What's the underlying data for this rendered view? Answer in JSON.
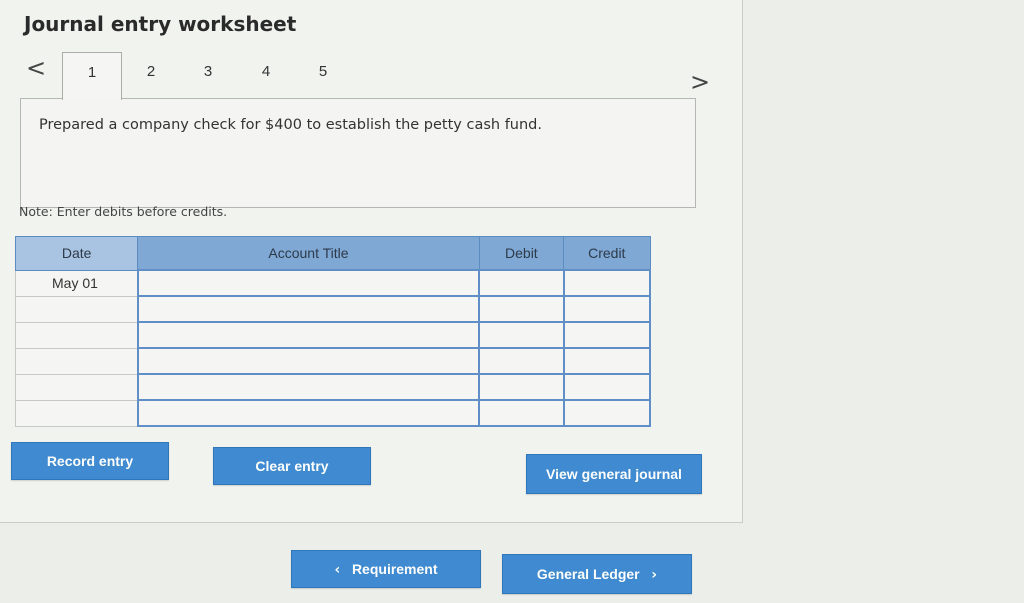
{
  "header": {
    "title": "Journal entry worksheet"
  },
  "tabs": [
    "1",
    "2",
    "3",
    "4",
    "5"
  ],
  "nav": {
    "prev": "<",
    "next": ">"
  },
  "transaction": {
    "description": "Prepared a company check for $400 to establish the petty cash fund."
  },
  "note": "Note: Enter debits before credits.",
  "table": {
    "headers": {
      "date": "Date",
      "account_title": "Account Title",
      "debit": "Debit",
      "credit": "Credit"
    },
    "rows": [
      {
        "date": "May 01",
        "account": "",
        "debit": "",
        "credit": ""
      },
      {
        "date": "",
        "account": "",
        "debit": "",
        "credit": ""
      },
      {
        "date": "",
        "account": "",
        "debit": "",
        "credit": ""
      },
      {
        "date": "",
        "account": "",
        "debit": "",
        "credit": ""
      },
      {
        "date": "",
        "account": "",
        "debit": "",
        "credit": ""
      },
      {
        "date": "",
        "account": "",
        "debit": "",
        "credit": ""
      }
    ]
  },
  "buttons": {
    "record_entry": "Record entry",
    "clear_entry": "Clear entry",
    "view_general_journal": "View general journal",
    "requirement": "Requirement",
    "general_ledger": "General Ledger"
  }
}
